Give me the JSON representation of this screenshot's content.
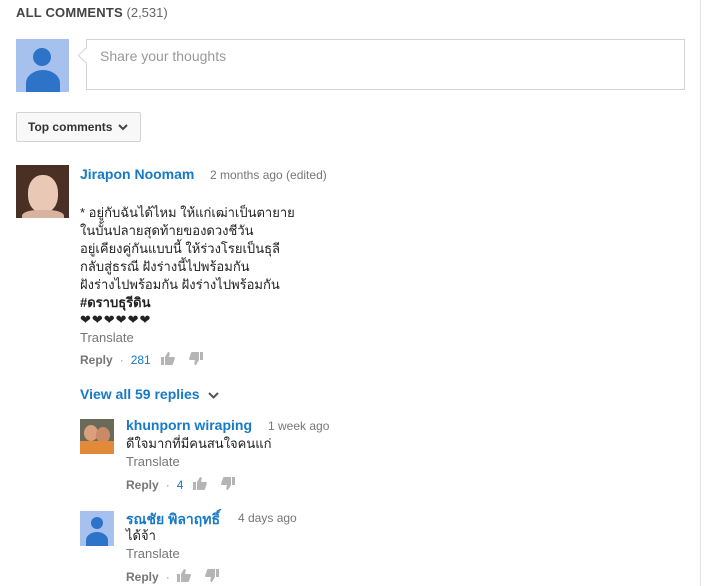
{
  "header": {
    "title": "ALL COMMENTS",
    "count": "(2,531)"
  },
  "composer": {
    "placeholder": "Share your thoughts"
  },
  "sort": {
    "label": "Top comments"
  },
  "comment": {
    "author": "Jirapon Noomam",
    "time": "2 months ago (edited)",
    "lines": [
      "* อยู่กับฉันได้ไหม  ให้แก่เฒ่าเป็นตายาย",
      "ในบั้นปลายสุดท้ายของดวงชีวัน",
      "อยู่เคียงคู่กันแบบนี้ ให้ร่วงโรยเป็นธุลี",
      "กลับสู่ธรณี ฝังร่างนี้ไปพร้อมกัน",
      "ฝังร่างไปพร้อมกัน ฝังร่างไปพร้อมกัน",
      "#ดราบธุรีดิน",
      "❤❤❤❤❤❤"
    ],
    "translate": "Translate",
    "reply": "Reply",
    "likes": "281"
  },
  "view_replies": "View all 59 replies",
  "replies": [
    {
      "author": "khunporn wiraping",
      "time": "1 week ago",
      "text": "ดีใจมากที่มีคนสนใจคนแก่",
      "translate": "Translate",
      "reply": "Reply",
      "likes": "4"
    },
    {
      "author": "รณชัย พิลาฤทธิ์",
      "time": "4 days ago",
      "text": "ได้จ้า",
      "translate": "Translate",
      "reply": "Reply",
      "likes": ""
    }
  ],
  "colors": {
    "link": "#167ac6",
    "muted": "#767676",
    "avatar_default_bg": "#a6c1ee",
    "avatar_default_fg": "#2d73c7"
  },
  "icons": [
    "user-avatar-icon",
    "chevron-down-icon",
    "thumbs-up-icon",
    "thumbs-down-icon"
  ]
}
